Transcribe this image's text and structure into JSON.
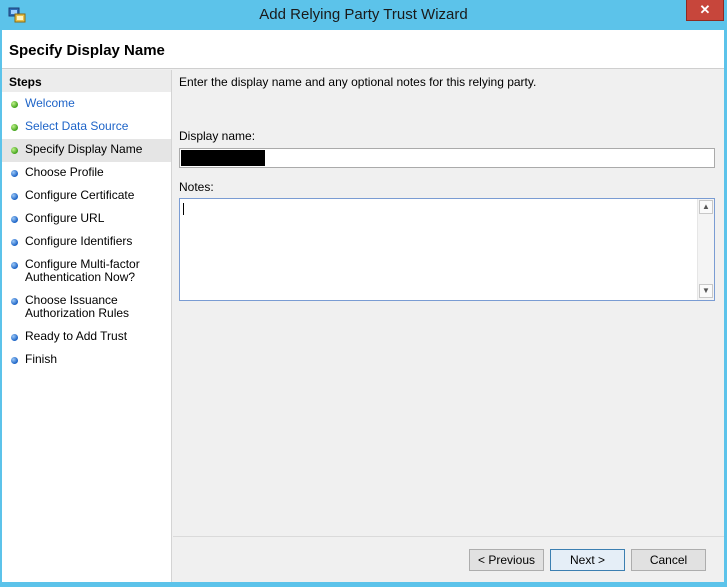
{
  "window": {
    "title": "Add Relying Party Trust Wizard",
    "close_glyph": "✕",
    "app_icon": "adfs-wizard-icon"
  },
  "header": {
    "page_title": "Specify Display Name"
  },
  "steps": {
    "heading": "Steps",
    "items": [
      {
        "label": "Welcome",
        "state": "done"
      },
      {
        "label": "Select Data Source",
        "state": "done"
      },
      {
        "label": "Specify Display Name",
        "state": "current"
      },
      {
        "label": "Choose Profile",
        "state": "pending"
      },
      {
        "label": "Configure Certificate",
        "state": "pending"
      },
      {
        "label": "Configure URL",
        "state": "pending"
      },
      {
        "label": "Configure Identifiers",
        "state": "pending"
      },
      {
        "label": "Configure Multi-factor\nAuthentication Now?",
        "state": "pending"
      },
      {
        "label": "Choose Issuance\nAuthorization Rules",
        "state": "pending"
      },
      {
        "label": "Ready to Add Trust",
        "state": "pending"
      },
      {
        "label": "Finish",
        "state": "pending"
      }
    ]
  },
  "content": {
    "instruction": "Enter the display name and any optional notes for this relying party.",
    "display_name_label": "Display name:",
    "display_name_value": "",
    "notes_label": "Notes:",
    "notes_value": ""
  },
  "scrollbar": {
    "up_glyph": "▲",
    "down_glyph": "▼"
  },
  "footer": {
    "previous_label": "< Previous",
    "next_label": "Next >",
    "cancel_label": "Cancel"
  },
  "colors": {
    "title_bar": "#5cc3ea",
    "done_step_text": "#1e64c8",
    "done_dot": "#41a21a",
    "pending_dot": "#1a62c5"
  }
}
